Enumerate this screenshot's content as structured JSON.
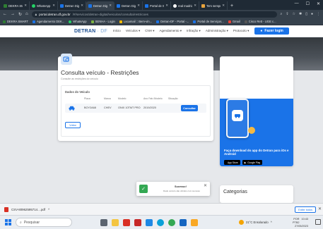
{
  "browser": {
    "tabs": [
      {
        "title": "DEKRA SMAF",
        "color": "#2e7d32"
      },
      {
        "title": "WhatsApp",
        "color": "#25d366"
      },
      {
        "title": "Detran Digit",
        "color": "#1a73e8"
      },
      {
        "title": "Detran Digit",
        "color": "#1a73e8"
      },
      {
        "title": "Detran Digit",
        "color": "#1a73e8"
      },
      {
        "title": "Portal de Se",
        "color": "#1a73e8"
      },
      {
        "title": "real madrid",
        "color": "#ffffff"
      },
      {
        "title": "Tem sempre",
        "color": "#e8a33d"
      }
    ],
    "new_tab": "+",
    "window_controls": {
      "min": "—",
      "max": "☐",
      "close": "✕"
    },
    "url_host": "portal.detran.df.gov.br",
    "url_path": "/#/servicos/detran-digital/veiculos/consulta/restricoes",
    "bookmarks": [
      {
        "label": "DEKRA SMART",
        "color": "#2e7d32"
      },
      {
        "label": "Agendamento DEK...",
        "color": "#1a73e8"
      },
      {
        "label": "WhatsApp",
        "color": "#25d366"
      },
      {
        "label": "SENHA - Login",
        "color": "#7cb342"
      },
      {
        "label": "Locamail :: Bem-vin...",
        "color": "#fbbc04"
      },
      {
        "label": "Detran-DF - Portal -...",
        "color": "#1a73e8"
      },
      {
        "label": "Portal de Serviços...",
        "color": "#1a73e8"
      },
      {
        "label": "Gmail",
        "color": "#ea4335"
      },
      {
        "label": "Cisco Rett - UGE c...",
        "color": "#555555"
      }
    ]
  },
  "site": {
    "logo_main": "DETRAN",
    "logo_sub": "· DF",
    "nav": [
      "Início",
      "Veículos ▾",
      "CNH ▾",
      "Agendamento ▾",
      "Infração ▾",
      "Administração ▾",
      "Protocolo ▾"
    ],
    "login": "Fazer login"
  },
  "card": {
    "title": "Consulta veículo - Restrições",
    "subtitle": "Consulte as restrições do veículo",
    "section_title": "Dados do Veículo",
    "columns": [
      "Placa",
      "Marca",
      "Modelo",
      "Ano Fab./Modelo",
      "Situação"
    ],
    "row": {
      "placa": "BOY2A68",
      "marca": "CHEV",
      "modelo": "ONIX 10TMT PRO",
      "ano": "2019/2020",
      "situacao": ""
    },
    "consultar": "Consultar",
    "voltar": "Voltar"
  },
  "promo": {
    "text": "Faça download do app do Detran para iOs e Android",
    "appstore": "App Store",
    "googleplay": "Google Play"
  },
  "toast": {
    "title": "Sucesso!",
    "message": "Dado veículo são obtidos com sucesso"
  },
  "categorias": {
    "title": "Categorias"
  },
  "download": {
    "filename": "CSV-80962595714....pdf",
    "show_all": "Exibir todos"
  },
  "taskbar": {
    "search_placeholder": "Pesquisar",
    "weather": "21°C Ensolarado",
    "lang": "POR PTB2",
    "time": "10:43",
    "date": "27/05/2023"
  },
  "colors": {
    "accent": "#1a73e8",
    "success": "#34a853"
  }
}
